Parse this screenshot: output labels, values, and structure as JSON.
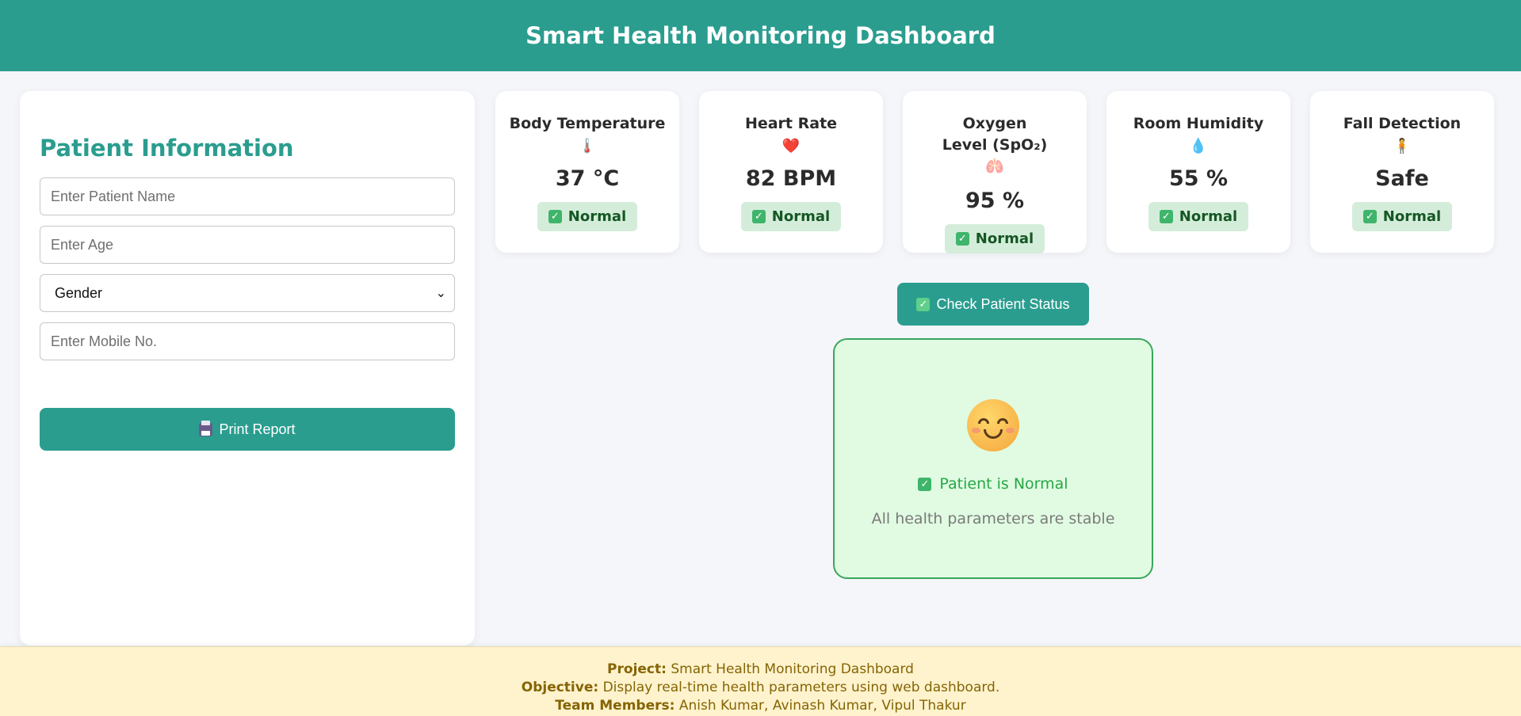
{
  "header": {
    "title": "Smart Health Monitoring Dashboard"
  },
  "patient": {
    "title": "Patient Information",
    "name_placeholder": "Enter Patient Name",
    "age_placeholder": "Enter Age",
    "gender_value": "Gender",
    "mobile_placeholder": "Enter Mobile No.",
    "print_label": "Print Report"
  },
  "cards": [
    {
      "title": "Body Temperature",
      "icon": "🌡️",
      "value": "37 °C",
      "status": "Normal"
    },
    {
      "title": "Heart Rate",
      "icon": "❤️",
      "value": "82 BPM",
      "status": "Normal"
    },
    {
      "title": "Oxygen Level (SpO₂)",
      "icon": "🫁",
      "value": "95 %",
      "status": "Normal"
    },
    {
      "title": "Room Humidity",
      "icon": "💧",
      "value": "55 %",
      "status": "Normal"
    },
    {
      "title": "Fall Detection",
      "icon": "🧍",
      "value": "Safe",
      "status": "Normal"
    }
  ],
  "check_button": {
    "label": "Check Patient Status"
  },
  "status": {
    "title": "Patient is Normal",
    "subtitle": "All health parameters are stable"
  },
  "footer": {
    "project_label": "Project:",
    "project_value": "Smart Health Monitoring Dashboard",
    "objective_label": "Objective:",
    "objective_value": "Display real-time health parameters using web dashboard.",
    "team_label": "Team Members:",
    "team_value": "Anish Kumar, Avinash Kumar, Vipul Thakur"
  },
  "colors": {
    "primary": "#2a9d8f",
    "success": "#28a745",
    "badge_bg": "#d4edda",
    "footer_bg": "#fff3cd",
    "footer_text": "#856404"
  }
}
